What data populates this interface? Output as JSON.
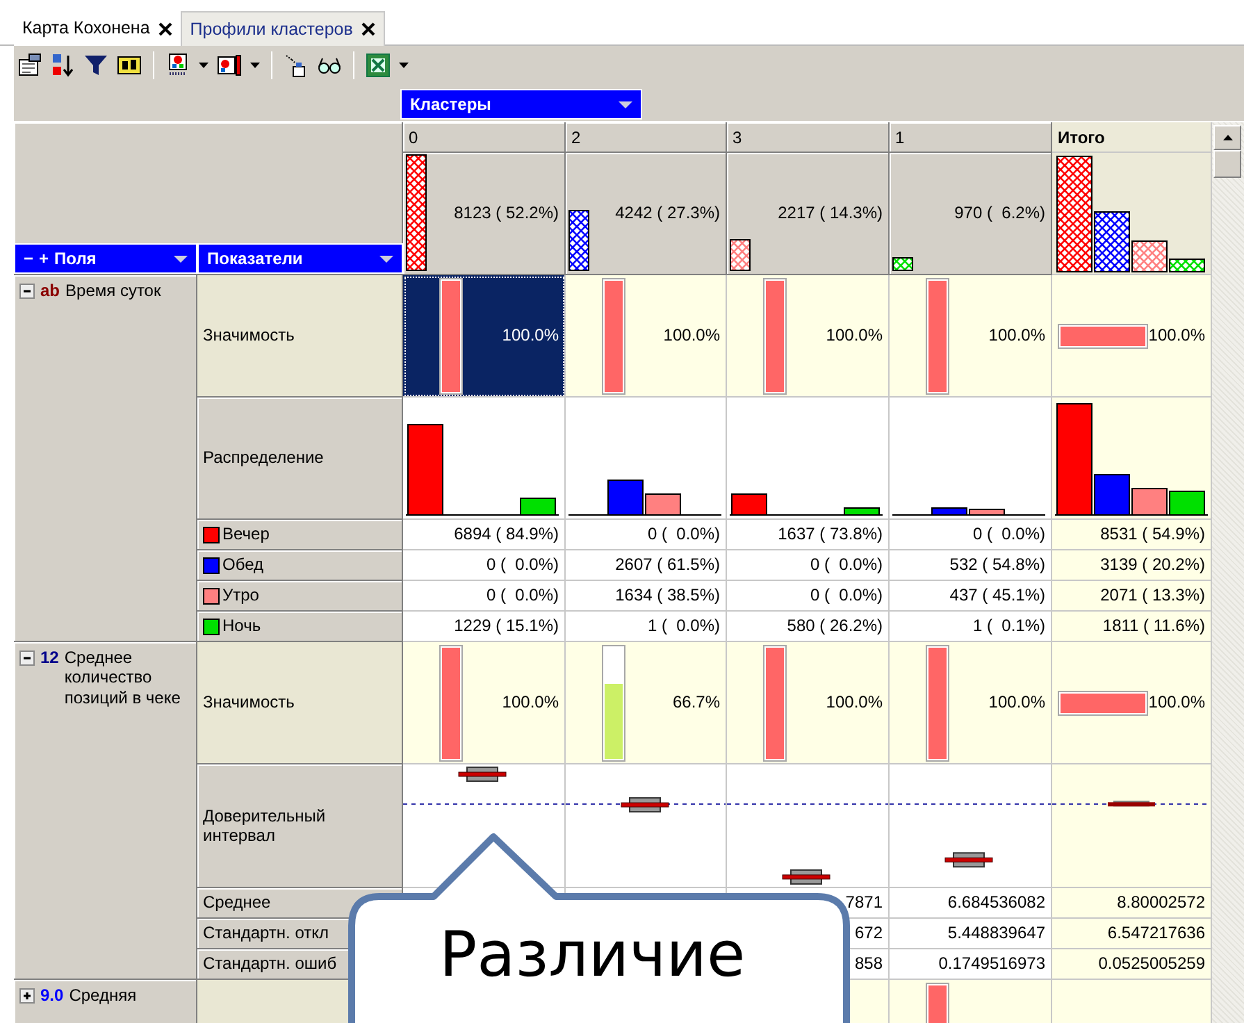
{
  "tabs": [
    {
      "label": "Карта Кохонена",
      "selected": false
    },
    {
      "label": "Профили кластеров",
      "selected": true
    }
  ],
  "cluster_header": {
    "label": "Кластеры"
  },
  "fields_header": {
    "controls": [
      "−",
      "+"
    ],
    "label": "Поля"
  },
  "indicators_header": {
    "label": "Показатели"
  },
  "clusters": [
    {
      "label": "0",
      "count": "8123 ( 52.2%)",
      "color": "#ff0000"
    },
    {
      "label": "2",
      "count": "4242 ( 27.3%)",
      "color": "#0000ff"
    },
    {
      "label": "3",
      "count": "2217 ( 14.3%)",
      "color": "#ff8080"
    },
    {
      "label": "1",
      "count": "970 (  6.2%)",
      "color": "#00e000"
    }
  ],
  "total": {
    "label": "Итого"
  },
  "groups": [
    {
      "kind": "text",
      "badge": "ab",
      "name": "Время суток",
      "expanded": true,
      "rows": [
        {
          "kind": "significance",
          "label": "Значимость",
          "cells": [
            {
              "level": 1,
              "reading": "100.0%",
              "selected": true
            },
            {
              "level": 1,
              "reading": "100.0%",
              "selected": false
            },
            {
              "level": 1,
              "reading": "100.0%",
              "selected": false
            },
            {
              "level": 1,
              "reading": "100.0%",
              "selected": false
            },
            {
              "level": 1,
              "reading": "100.0%",
              "selected": false
            }
          ]
        },
        {
          "kind": "distribution",
          "label": "Распределение"
        },
        {
          "kind": "category",
          "label": "Вечер",
          "color": "#ff0000",
          "cells": [
            "6894 ( 84.9%)",
            "0 (  0.0%)",
            "1637 ( 73.8%)",
            "0 (  0.0%)",
            "8531 ( 54.9%)"
          ]
        },
        {
          "kind": "category",
          "label": "Обед",
          "color": "#0000ff",
          "cells": [
            "0 (  0.0%)",
            "2607 ( 61.5%)",
            "0 (  0.0%)",
            "532 ( 54.8%)",
            "3139 ( 20.2%)"
          ]
        },
        {
          "kind": "category",
          "label": "Утро",
          "color": "#ff8080",
          "cells": [
            "0 (  0.0%)",
            "1634 ( 38.5%)",
            "0 (  0.0%)",
            "437 ( 45.1%)",
            "2071 ( 13.3%)"
          ]
        },
        {
          "kind": "category",
          "label": "Ночь",
          "color": "#00e000",
          "cells": [
            "1229 ( 15.1%)",
            "1 (  0.0%)",
            "580 ( 26.2%)",
            "1 (  0.1%)",
            "1811 ( 11.6%)"
          ]
        }
      ]
    },
    {
      "kind": "integer",
      "badge": "12",
      "name": "Среднее количество позиций в чеке",
      "expanded": true,
      "rows": [
        {
          "kind": "significance",
          "label": "Значимость",
          "cells": [
            {
              "level": 1,
              "reading": "100.0%",
              "selected": false
            },
            {
              "level": 0.667,
              "reading": "66.7%",
              "selected": false
            },
            {
              "level": 1,
              "reading": "100.0%",
              "selected": false
            },
            {
              "level": 1,
              "reading": "100.0%",
              "selected": false
            },
            {
              "level": 1,
              "reading": "100.0%",
              "selected": false
            }
          ]
        },
        {
          "kind": "interval",
          "label": "Доверительный интервал"
        },
        {
          "kind": "stat",
          "label": "Среднее",
          "cells": [
            null,
            null,
            "7871",
            "6.684536082",
            "8.80002572"
          ]
        },
        {
          "kind": "stat",
          "label": "Стандартн. откл",
          "cells": [
            null,
            null,
            "672",
            "5.448839647",
            "6.547217636"
          ]
        },
        {
          "kind": "stat",
          "label": "Стандартн. ошиб",
          "cells": [
            null,
            null,
            "858",
            "0.1749516973",
            "0.0525005259"
          ]
        }
      ]
    },
    {
      "kind": "real",
      "badge": "9.0",
      "name": "Средняя",
      "expanded": false,
      "rows": [
        {
          "kind": "significance",
          "cells": [
            null,
            null,
            null,
            {
              "level": 1,
              "selected": false
            },
            null
          ]
        }
      ]
    }
  ],
  "callout": {
    "text": "Различие"
  }
}
